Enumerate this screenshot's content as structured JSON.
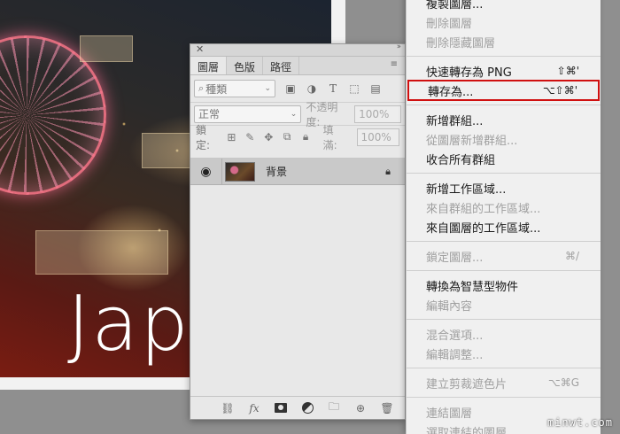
{
  "photo": {
    "overlay_text": "Jap"
  },
  "layers_panel": {
    "tabs": [
      {
        "label": "圖層",
        "active": true
      },
      {
        "label": "色版",
        "active": false
      },
      {
        "label": "路徑",
        "active": false
      }
    ],
    "filter": {
      "label": "種類"
    },
    "blend_mode": "正常",
    "opacity_label": "不透明度:",
    "opacity_value": "100%",
    "lock_label": "鎖定:",
    "fill_label": "填滿:",
    "fill_value": "100%",
    "layers": [
      {
        "name": "背景",
        "visible": true,
        "locked": true
      }
    ]
  },
  "context_menu": {
    "items": [
      {
        "label": "複製圖層...",
        "disabled": false
      },
      {
        "label": "刪除圖層",
        "disabled": true
      },
      {
        "label": "刪除隱藏圖層",
        "disabled": true
      },
      {
        "sep": true
      },
      {
        "label": "快速轉存為 PNG",
        "shortcut": "⇧⌘'",
        "disabled": false
      },
      {
        "label": "轉存為...",
        "shortcut": "⌥⇧⌘'",
        "disabled": false,
        "highlighted": true
      },
      {
        "sep": true
      },
      {
        "label": "新增群組...",
        "disabled": false
      },
      {
        "label": "從圖層新增群組...",
        "disabled": true
      },
      {
        "label": "收合所有群組",
        "disabled": false
      },
      {
        "sep": true
      },
      {
        "label": "新增工作區域...",
        "disabled": false
      },
      {
        "label": "來自群組的工作區域...",
        "disabled": true
      },
      {
        "label": "來自圖層的工作區域...",
        "disabled": false
      },
      {
        "sep": true
      },
      {
        "label": "鎖定圖層...",
        "shortcut": "⌘/",
        "disabled": true
      },
      {
        "sep": true
      },
      {
        "label": "轉換為智慧型物件",
        "disabled": false
      },
      {
        "label": "編輯內容",
        "disabled": true
      },
      {
        "sep": true
      },
      {
        "label": "混合選項...",
        "disabled": true
      },
      {
        "label": "編輯調整...",
        "disabled": true
      },
      {
        "sep": true
      },
      {
        "label": "建立剪裁遮色片",
        "shortcut": "⌥⌘G",
        "disabled": true
      },
      {
        "sep": true
      },
      {
        "label": "連結圖層",
        "disabled": true
      },
      {
        "label": "選取連結的圖層",
        "disabled": true
      }
    ]
  },
  "watermark": "minwt.com",
  "colors": {
    "highlight_border": "#d01010",
    "disabled_text": "#a0a0a0"
  }
}
